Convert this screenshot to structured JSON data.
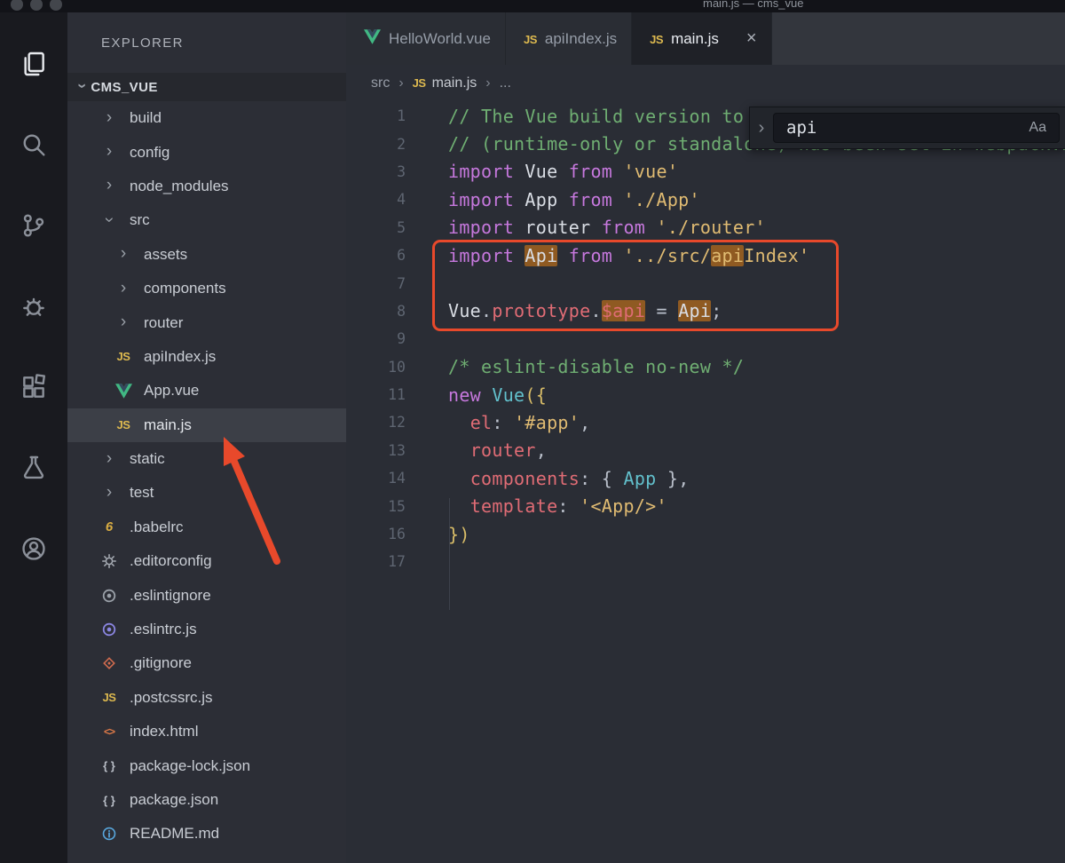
{
  "window": {
    "title": "main.js — cms_vue"
  },
  "colors": {
    "annotation": "#e8492b",
    "find_match_bg": "#8f5a22",
    "js_icon_yellow": "#ddb94f",
    "vue_green": "#41b883",
    "selected_row_bg": "#3c3f47"
  },
  "activity_bar": {
    "items": [
      {
        "name": "explorer-icon",
        "icon": "explorer",
        "active": true
      },
      {
        "name": "search-icon",
        "icon": "search",
        "active": false
      },
      {
        "name": "source-control-icon",
        "icon": "scm",
        "active": false
      },
      {
        "name": "debug-icon",
        "icon": "debug",
        "active": false
      },
      {
        "name": "extensions-icon",
        "icon": "extensions",
        "active": false
      },
      {
        "name": "test-beaker-icon",
        "icon": "beaker",
        "active": false
      },
      {
        "name": "account-icon",
        "icon": "account",
        "active": false
      }
    ]
  },
  "sidebar": {
    "header": "EXPLORER",
    "project": "CMS_VUE",
    "items": [
      {
        "label": "build",
        "type": "folder",
        "level": 0,
        "expanded": false
      },
      {
        "label": "config",
        "type": "folder",
        "level": 0,
        "expanded": false
      },
      {
        "label": "node_modules",
        "type": "folder",
        "level": 0,
        "expanded": false
      },
      {
        "label": "src",
        "type": "folder",
        "level": 0,
        "expanded": true
      },
      {
        "label": "assets",
        "type": "folder",
        "level": 1,
        "expanded": false
      },
      {
        "label": "components",
        "type": "folder",
        "level": 1,
        "expanded": false
      },
      {
        "label": "router",
        "type": "folder",
        "level": 1,
        "expanded": false
      },
      {
        "label": "apiIndex.js",
        "type": "file",
        "icon": "js",
        "level": 1
      },
      {
        "label": "App.vue",
        "type": "file",
        "icon": "vue",
        "level": 1
      },
      {
        "label": "main.js",
        "type": "file",
        "icon": "js",
        "level": 1,
        "selected": true
      },
      {
        "label": "static",
        "type": "folder",
        "level": 0,
        "expanded": false
      },
      {
        "label": "test",
        "type": "folder",
        "level": 0,
        "expanded": false
      },
      {
        "label": ".babelrc",
        "type": "file",
        "icon": "babel",
        "level": 0
      },
      {
        "label": ".editorconfig",
        "type": "file",
        "icon": "gear",
        "level": 0
      },
      {
        "label": ".eslintignore",
        "type": "file",
        "icon": "eslint-gray",
        "level": 0
      },
      {
        "label": ".eslintrc.js",
        "type": "file",
        "icon": "eslint",
        "level": 0
      },
      {
        "label": ".gitignore",
        "type": "file",
        "icon": "git",
        "level": 0
      },
      {
        "label": ".postcssrc.js",
        "type": "file",
        "icon": "js",
        "level": 0
      },
      {
        "label": "index.html",
        "type": "file",
        "icon": "html",
        "level": 0
      },
      {
        "label": "package-lock.json",
        "type": "file",
        "icon": "json",
        "level": 0
      },
      {
        "label": "package.json",
        "type": "file",
        "icon": "json",
        "level": 0
      },
      {
        "label": "README.md",
        "type": "file",
        "icon": "info",
        "level": 0
      }
    ]
  },
  "editor": {
    "tabs": [
      {
        "label": "HelloWorld.vue",
        "icon": "vue",
        "active": false
      },
      {
        "label": "apiIndex.js",
        "icon": "js",
        "active": false
      },
      {
        "label": "main.js",
        "icon": "js",
        "active": true,
        "close_label": "×"
      }
    ],
    "breadcrumb": {
      "separator": "›",
      "items": [
        {
          "label": "src"
        },
        {
          "label": "main.js",
          "icon": "js",
          "current": true
        },
        {
          "label": "..."
        }
      ]
    },
    "find_widget": {
      "chevron": "›",
      "query": "api",
      "match_case_label": "Aa"
    },
    "code_lines": [
      {
        "n": 1,
        "t": [
          [
            "cm",
            "// The Vue build version to load with the `import` command"
          ]
        ]
      },
      {
        "n": 2,
        "t": [
          [
            "cm",
            "// (runtime-only or standalone) has been set in webpack.base.conf with an alias."
          ]
        ]
      },
      {
        "n": 3,
        "t": [
          [
            "kw",
            "import "
          ],
          [
            "vr",
            "Vue"
          ],
          [
            "kw",
            " from "
          ],
          [
            "st",
            "'vue'"
          ]
        ]
      },
      {
        "n": 4,
        "t": [
          [
            "kw",
            "import "
          ],
          [
            "vr",
            "App"
          ],
          [
            "kw",
            " from "
          ],
          [
            "st",
            "'./App'"
          ]
        ]
      },
      {
        "n": 5,
        "t": [
          [
            "kw",
            "import "
          ],
          [
            "vr",
            "router"
          ],
          [
            "kw",
            " from "
          ],
          [
            "st",
            "'./router'"
          ]
        ]
      },
      {
        "n": 6,
        "t": [
          [
            "kw",
            "import "
          ],
          [
            "vr",
            "Api",
            1
          ],
          [
            "kw",
            " from "
          ],
          [
            "st",
            "'../src/"
          ],
          [
            "st",
            "api",
            1
          ],
          [
            "st",
            "Index'"
          ]
        ]
      },
      {
        "n": 7,
        "t": []
      },
      {
        "n": 8,
        "t": [
          [
            "vr",
            "Vue"
          ],
          [
            "df",
            "."
          ],
          [
            "pr",
            "prototype"
          ],
          [
            "df",
            "."
          ],
          [
            "pr",
            "$api",
            1
          ],
          [
            "df",
            " = "
          ],
          [
            "vr",
            "Api",
            1
          ],
          [
            "df",
            ";"
          ]
        ]
      },
      {
        "n": 9,
        "t": []
      },
      {
        "n": 10,
        "t": [
          [
            "cm",
            "/* eslint-disable no-new */"
          ]
        ]
      },
      {
        "n": 11,
        "t": [
          [
            "kw",
            "new "
          ],
          [
            "ty",
            "Vue"
          ],
          [
            "br",
            "({"
          ]
        ]
      },
      {
        "n": 12,
        "t": [
          [
            "df",
            "  "
          ],
          [
            "pr",
            "el"
          ],
          [
            "df",
            ": "
          ],
          [
            "st",
            "'#app'"
          ],
          [
            "df",
            ","
          ]
        ]
      },
      {
        "n": 13,
        "t": [
          [
            "df",
            "  "
          ],
          [
            "pr",
            "router"
          ],
          [
            "df",
            ","
          ]
        ]
      },
      {
        "n": 14,
        "t": [
          [
            "df",
            "  "
          ],
          [
            "pr",
            "components"
          ],
          [
            "df",
            ": { "
          ],
          [
            "ty",
            "App"
          ],
          [
            "df",
            " },"
          ]
        ]
      },
      {
        "n": 15,
        "t": [
          [
            "df",
            "  "
          ],
          [
            "pr",
            "template"
          ],
          [
            "df",
            ": "
          ],
          [
            "st",
            "'<App/>'"
          ]
        ]
      },
      {
        "n": 16,
        "t": [
          [
            "br",
            "})"
          ]
        ]
      },
      {
        "n": 17,
        "t": []
      }
    ]
  }
}
